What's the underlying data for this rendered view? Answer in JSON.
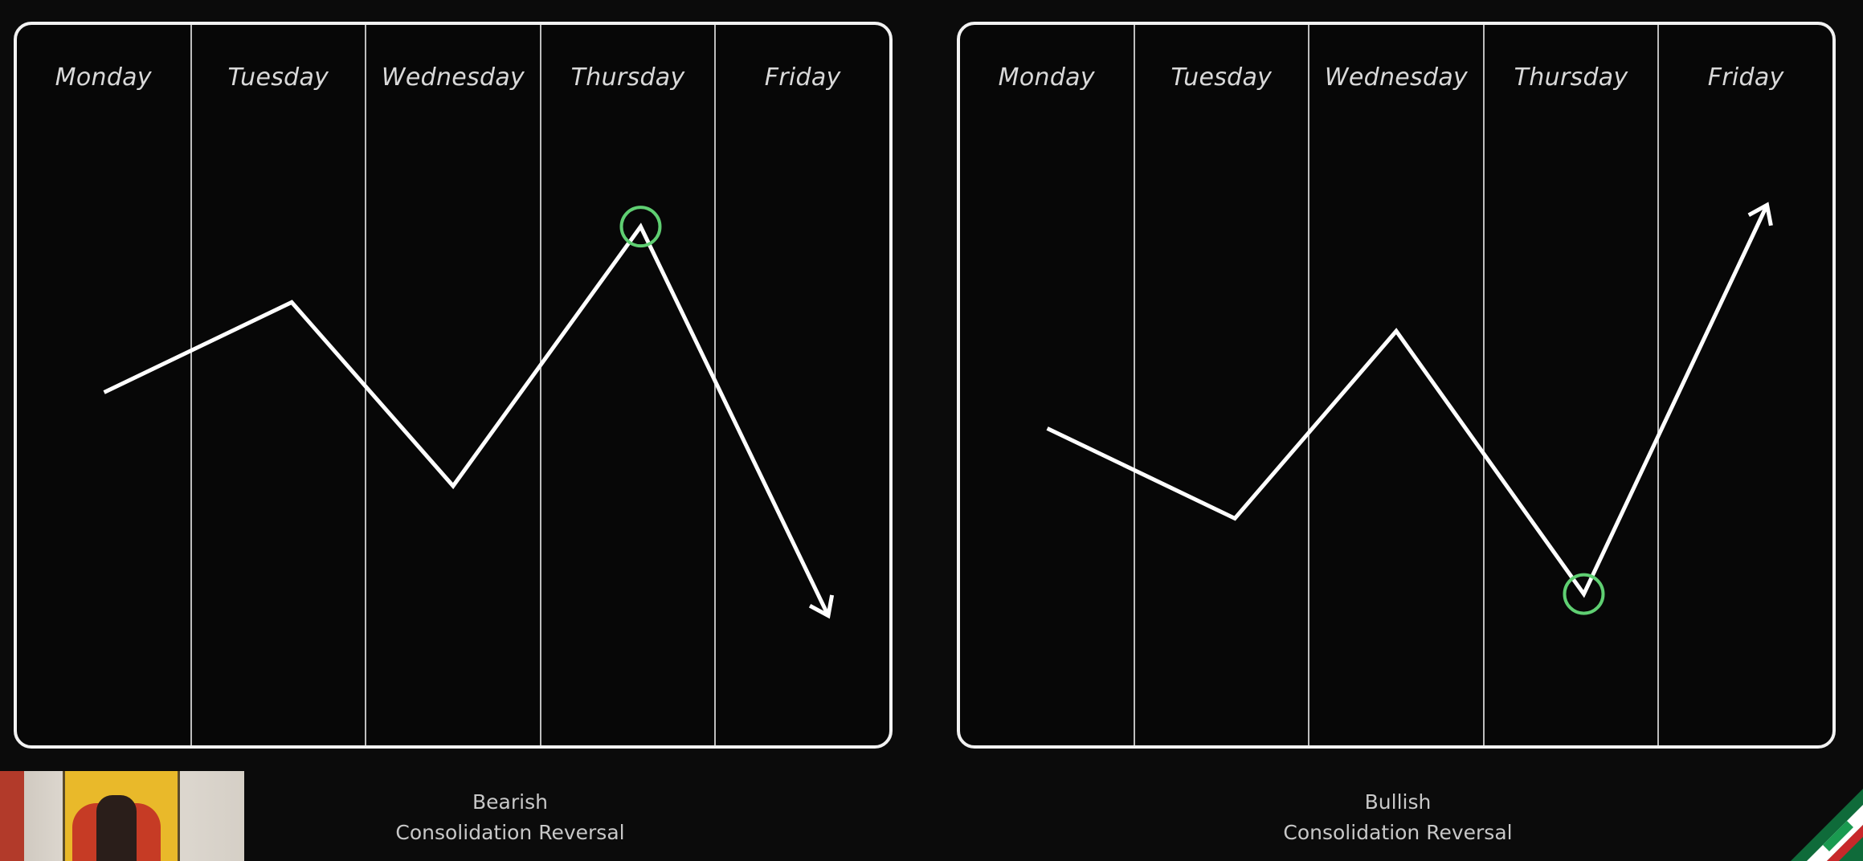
{
  "panels": [
    {
      "days": [
        "Monday",
        "Tuesday",
        "Wednesday",
        "Thursday",
        "Friday"
      ],
      "highlight_index": 3,
      "path": [
        [
          0.1,
          0.51
        ],
        [
          0.315,
          0.385
        ],
        [
          0.5,
          0.64
        ],
        [
          0.715,
          0.28
        ]
      ],
      "arrow_end": [
        0.93,
        0.82
      ],
      "marker": [
        0.715,
        0.28
      ],
      "caption": [
        "Bearish",
        "Consolidation Reversal"
      ]
    },
    {
      "days": [
        "Monday",
        "Tuesday",
        "Wednesday",
        "Thursday",
        "Friday"
      ],
      "highlight_index": 3,
      "path": [
        [
          0.1,
          0.56
        ],
        [
          0.315,
          0.685
        ],
        [
          0.5,
          0.425
        ],
        [
          0.715,
          0.79
        ]
      ],
      "arrow_end": [
        0.925,
        0.25
      ],
      "marker": [
        0.715,
        0.79
      ],
      "caption": [
        "Bullish",
        "Consolidation Reversal"
      ]
    }
  ],
  "colors": {
    "line": "#ffffff",
    "marker": "#5fcf72",
    "highlight": "#202020"
  },
  "icons": {
    "webcam": "webcam-thumbnail",
    "corner_logo": "brand-logo-icon"
  }
}
